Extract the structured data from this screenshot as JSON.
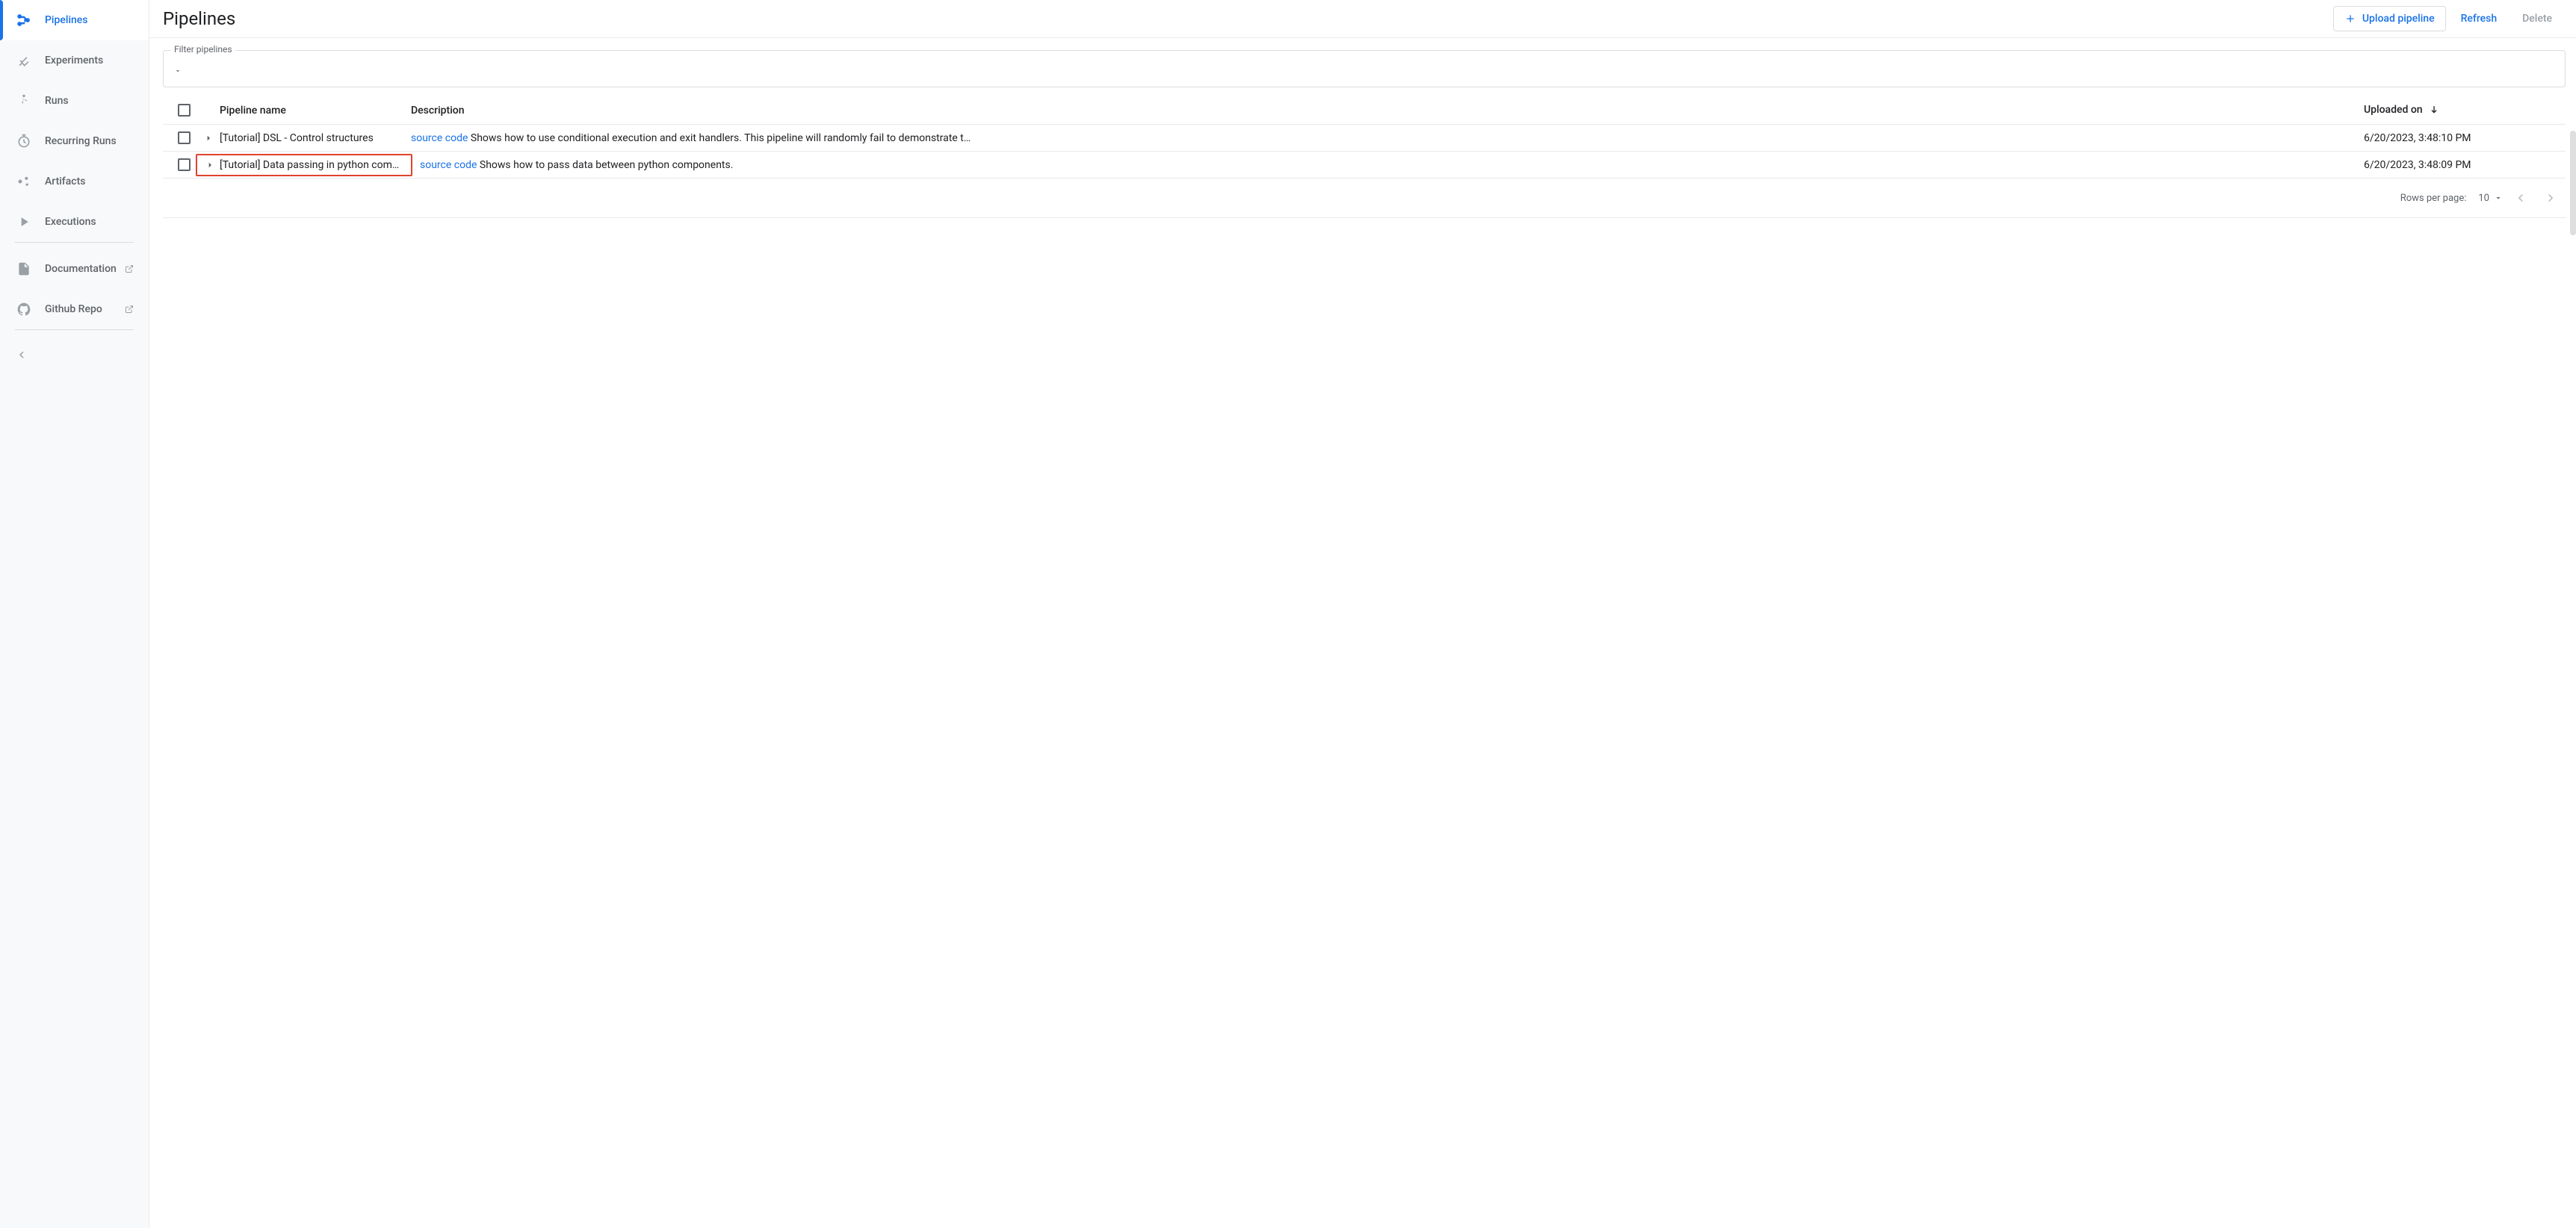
{
  "page": {
    "title": "Pipelines"
  },
  "nav": {
    "pipelines": "Pipelines",
    "experiments": "Experiments",
    "runs": "Runs",
    "recurring_runs": "Recurring Runs",
    "artifacts": "Artifacts",
    "executions": "Executions",
    "documentation": "Documentation",
    "github": "Github Repo"
  },
  "header": {
    "upload": "Upload pipeline",
    "refresh": "Refresh",
    "delete": "Delete"
  },
  "filter": {
    "legend": "Filter pipelines"
  },
  "table": {
    "columns": {
      "name": "Pipeline name",
      "description": "Description",
      "uploaded": "Uploaded on"
    },
    "rows": [
      {
        "name": "[Tutorial] DSL - Control structures",
        "source_label": "source code",
        "desc": " Shows how to use conditional execution and exit handlers. This pipeline will randomly fail to demonstrate t…",
        "uploaded": "6/20/2023, 3:48:10 PM"
      },
      {
        "name": "[Tutorial] Data passing in python comp…",
        "source_label": "source code",
        "desc": " Shows how to pass data between python components.",
        "uploaded": "6/20/2023, 3:48:09 PM"
      }
    ]
  },
  "pagination": {
    "rows_label": "Rows per page:",
    "page_size": "10"
  }
}
